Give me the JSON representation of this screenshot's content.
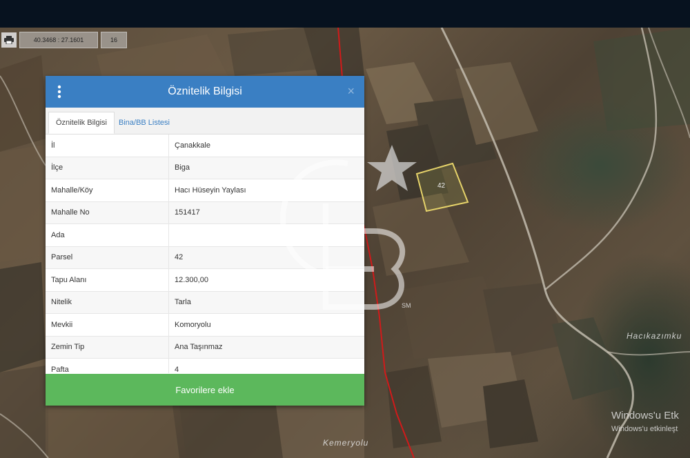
{
  "toolbar": {
    "print_icon": "printer-icon",
    "coordinates": "40.3468 : 27.1601",
    "zoom": "16"
  },
  "panel": {
    "title": "Öznitelik Bilgisi",
    "close_label": "×",
    "menu_icon": "vertical-dots-icon",
    "tabs": [
      {
        "label": "Öznitelik Bilgisi"
      },
      {
        "label": "Bina/BB Listesi"
      }
    ],
    "rows": [
      {
        "key": "İl",
        "value": "Çanakkale"
      },
      {
        "key": "İlçe",
        "value": "Biga"
      },
      {
        "key": "Mahalle/Köy",
        "value": "Hacı Hüseyin Yaylası"
      },
      {
        "key": "Mahalle No",
        "value": "151417"
      },
      {
        "key": "Ada",
        "value": ""
      },
      {
        "key": "Parsel",
        "value": "42"
      },
      {
        "key": "Tapu Alanı",
        "value": "12.300,00"
      },
      {
        "key": "Nitelik",
        "value": "Tarla"
      },
      {
        "key": "Mevkii",
        "value": "Komoryolu"
      },
      {
        "key": "Zemin Tip",
        "value": "Ana Taşınmaz"
      },
      {
        "key": "Pafta",
        "value": "4"
      }
    ],
    "favorite_button": "Favorilere ekle"
  },
  "map": {
    "parcel_label": "42",
    "labels": [
      "Kemeryolu",
      "Hacıkazımku",
      "SM"
    ]
  },
  "system": {
    "windows_line1": "Windows'u Etk",
    "windows_line2": "Windows'u etkinleşt"
  },
  "colors": {
    "header": "#3a7fc3",
    "button": "#5cb85c",
    "parcel_outline": "#e6d36a",
    "boundary_line": "#d11a1a"
  }
}
